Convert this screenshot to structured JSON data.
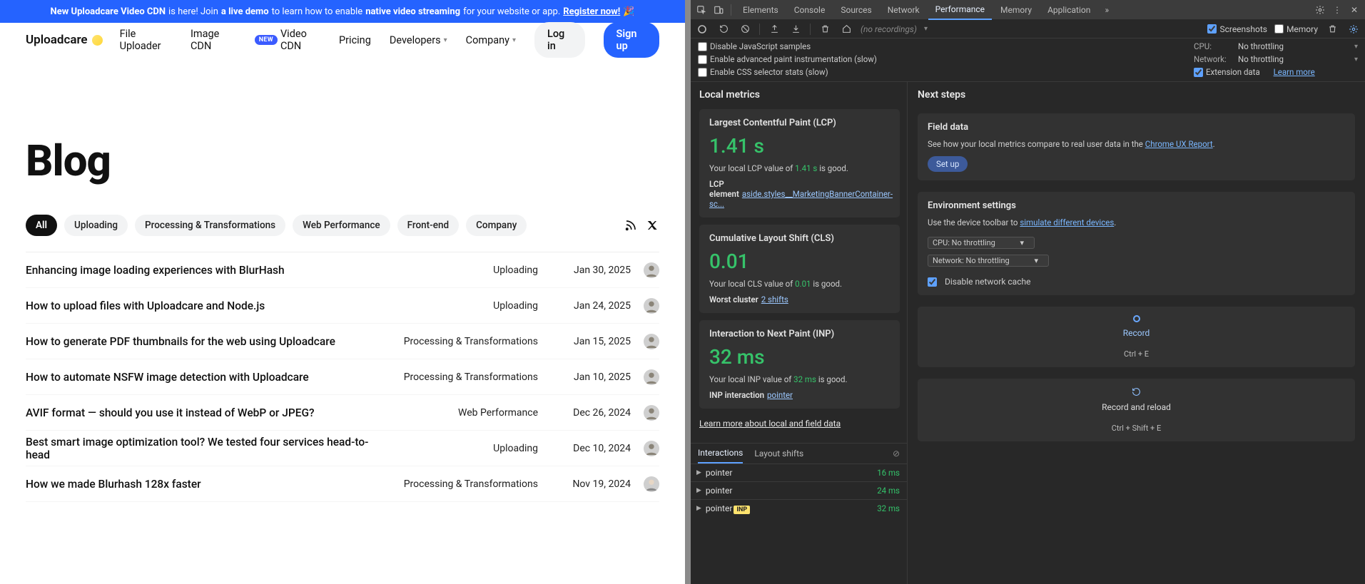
{
  "site": {
    "banner": {
      "t1": "New Uploadcare Video CDN",
      "t2": " is here! Join ",
      "t3": "a live demo",
      "t4": " to learn how to enable ",
      "t5": "native video streaming",
      "t6": " for your website or app. ",
      "reg": "Register now!",
      "emoji": "🎉"
    },
    "logo": "Uploadcare",
    "nav": {
      "uploader": "File Uploader",
      "imagecdn": "Image CDN",
      "newbadge": "NEW",
      "videocdn": "Video CDN",
      "pricing": "Pricing",
      "developers": "Developers",
      "company": "Company",
      "login": "Log in",
      "signup": "Sign up"
    },
    "title": "Blog",
    "tags": [
      "All",
      "Uploading",
      "Processing & Transformations",
      "Web Performance",
      "Front-end",
      "Company"
    ],
    "posts": [
      {
        "title": "Enhancing image loading experiences with BlurHash",
        "cat": "Uploading",
        "date": "Jan 30, 2025"
      },
      {
        "title": "How to upload files with Uploadcare and Node.js",
        "cat": "Uploading",
        "date": "Jan 24, 2025"
      },
      {
        "title": "How to generate PDF thumbnails for the web using Uploadcare",
        "cat": "Processing & Transformations",
        "date": "Jan 15, 2025"
      },
      {
        "title": "How to automate NSFW image detection with Uploadcare",
        "cat": "Processing & Transformations",
        "date": "Jan 10, 2025"
      },
      {
        "title": "AVIF format — should you use it instead of WebP or JPEG?",
        "cat": "Web Performance",
        "date": "Dec 26, 2024"
      },
      {
        "title": "Best smart image optimization tool? We tested four services head-to-head",
        "cat": "Uploading",
        "date": "Dec 10, 2024"
      },
      {
        "title": "How we made Blurhash 128x faster",
        "cat": "Processing & Transformations",
        "date": "Nov 19, 2024"
      }
    ]
  },
  "dev": {
    "tabs": [
      "Elements",
      "Console",
      "Sources",
      "Network",
      "Performance",
      "Memory",
      "Application"
    ],
    "toolbar": {
      "norec": "(no recordings)",
      "screenshots": "Screenshots",
      "memory": "Memory"
    },
    "opts": {
      "js": "Disable JavaScript samples",
      "paint": "Enable advanced paint instrumentation (slow)",
      "css": "Enable CSS selector stats (slow)",
      "cpuLbl": "CPU:",
      "cpuVal": "No throttling",
      "netLbl": "Network:",
      "netVal": "No throttling",
      "ext": "Extension data",
      "learn": "Learn more"
    },
    "localTitle": "Local metrics",
    "lcp": {
      "name": "Largest Contentful Paint (LCP)",
      "val": "1.41 s",
      "desc1": "Your local LCP value of ",
      "descV": "1.41 s",
      "desc2": " is good.",
      "subk": "LCP element",
      "subv": "aside.styles__MarketingBannerContainer-sc..."
    },
    "cls": {
      "name": "Cumulative Layout Shift (CLS)",
      "val": "0.01",
      "desc1": "Your local CLS value of ",
      "descV": "0.01",
      "desc2": " is good.",
      "subk": "Worst cluster",
      "subv": "2 shifts"
    },
    "inp": {
      "name": "Interaction to Next Paint (INP)",
      "val": "32 ms",
      "desc1": "Your local INP value of ",
      "descV": "32 ms",
      "desc2": " is good.",
      "subk": "INP interaction",
      "subv": "pointer"
    },
    "learnLocal": "Learn more about local and field data",
    "itabs": {
      "interactions": "Interactions",
      "shifts": "Layout shifts"
    },
    "irows": [
      {
        "name": "pointer",
        "ms": "16 ms",
        "inp": false
      },
      {
        "name": "pointer",
        "ms": "24 ms",
        "inp": false
      },
      {
        "name": "pointer",
        "ms": "32 ms",
        "inp": true
      }
    ],
    "inpBadge": "INP",
    "next": {
      "title": "Next steps",
      "field": {
        "title": "Field data",
        "t1": "See how your local metrics compare to real user data in the ",
        "link": "Chrome UX Report",
        "t2": ".",
        "btn": "Set up"
      },
      "env": {
        "title": "Environment settings",
        "t1": "Use the device toolbar to ",
        "link": "simulate different devices",
        "t2": ".",
        "cpu": "CPU: No throttling",
        "net": "Network: No throttling",
        "cache": "Disable network cache"
      },
      "rec": {
        "label": "Record",
        "sc": "Ctrl + E"
      },
      "recReload": {
        "label": "Record and reload",
        "sc": "Ctrl + Shift + E"
      }
    }
  }
}
